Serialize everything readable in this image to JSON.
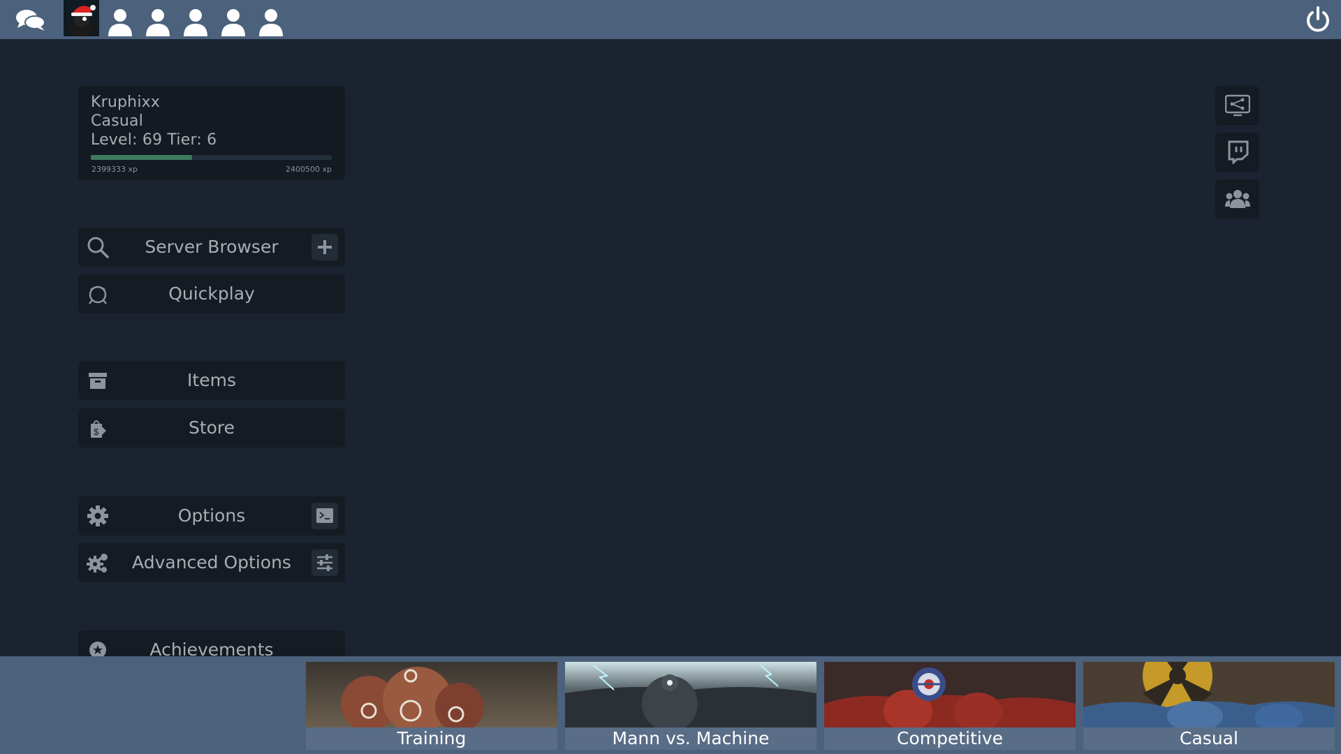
{
  "topbar": {
    "party_slots": [
      "party-slot-1",
      "party-slot-2",
      "party-slot-3",
      "party-slot-4",
      "party-slot-5"
    ]
  },
  "profile": {
    "name": "Kruphixx",
    "mode": "Casual",
    "level_tier": "Level: 69 Tier: 6",
    "xp_current": "2399333 xp",
    "xp_next": "2400500 xp",
    "xp_progress": 0.42
  },
  "menu": {
    "server_browser": "Server Browser",
    "quickplay": "Quickplay",
    "items": "Items",
    "store": "Store",
    "options": "Options",
    "advanced_options": "Advanced Options",
    "achievements": "Achievements"
  },
  "modes": [
    {
      "label": "Training"
    },
    {
      "label": "Mann vs. Machine"
    },
    {
      "label": "Competitive"
    },
    {
      "label": "Casual"
    }
  ],
  "colors": {
    "topbar": "#4b617c",
    "background": "#1b2330",
    "panel": "#151b22",
    "xp_fill": "#3e7a5e"
  }
}
